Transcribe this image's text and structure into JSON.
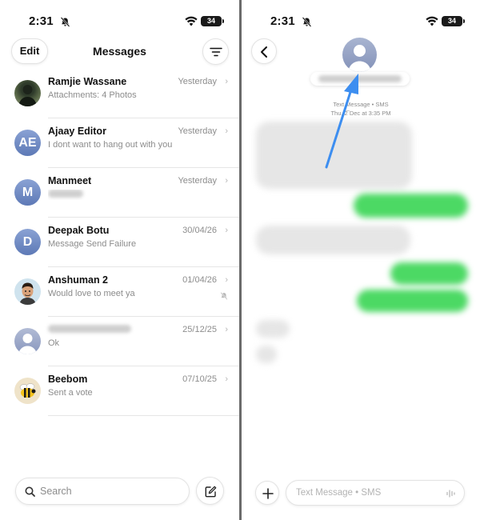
{
  "status": {
    "time": "2:31",
    "battery": "34"
  },
  "left": {
    "edit_label": "Edit",
    "title": "Messages",
    "search_placeholder": "Search",
    "conversations": [
      {
        "name": "Ramjie Wassane",
        "preview": "Attachments: 4 Photos",
        "date": "Yesterday",
        "avatar": "photo"
      },
      {
        "name": "Ajaay Editor",
        "preview": "I dont want to hang out with you",
        "date": "Yesterday",
        "avatar": "initials",
        "initials": "AE"
      },
      {
        "name": "Manmeet",
        "preview": "",
        "date": "Yesterday",
        "avatar": "initials",
        "initials": "M"
      },
      {
        "name": "Deepak Botu",
        "preview": "Message Send Failure",
        "date": "30/04/26",
        "avatar": "initials",
        "initials": "D"
      },
      {
        "name": "Anshuman 2",
        "preview": "Would love to meet ya",
        "date": "01/04/26",
        "avatar": "memoji",
        "muted": true
      },
      {
        "name": "",
        "preview": "Ok",
        "date": "25/12/25",
        "avatar": "unknown"
      },
      {
        "name": "Beebom",
        "preview": "Sent a vote",
        "date": "07/10/25",
        "avatar": "bee"
      }
    ]
  },
  "right": {
    "meta_line1": "Text Message • SMS",
    "meta_line2": "Thu, 2̅ Dec at 3:35 PM",
    "input_placeholder": "Text Message • SMS"
  },
  "colors": {
    "outgoing": "#4cd964",
    "incoming": "#e6e6e6",
    "arrow": "#3d8ef0",
    "avatar": "#6f87c0"
  },
  "icons": [
    "bell-slash-icon",
    "wifi-icon",
    "battery-icon",
    "filter-icon",
    "chevron-right-icon",
    "search-icon",
    "compose-icon",
    "chevron-left-icon",
    "person-icon",
    "plus-icon",
    "waveform-icon",
    "arrow-annotation"
  ]
}
